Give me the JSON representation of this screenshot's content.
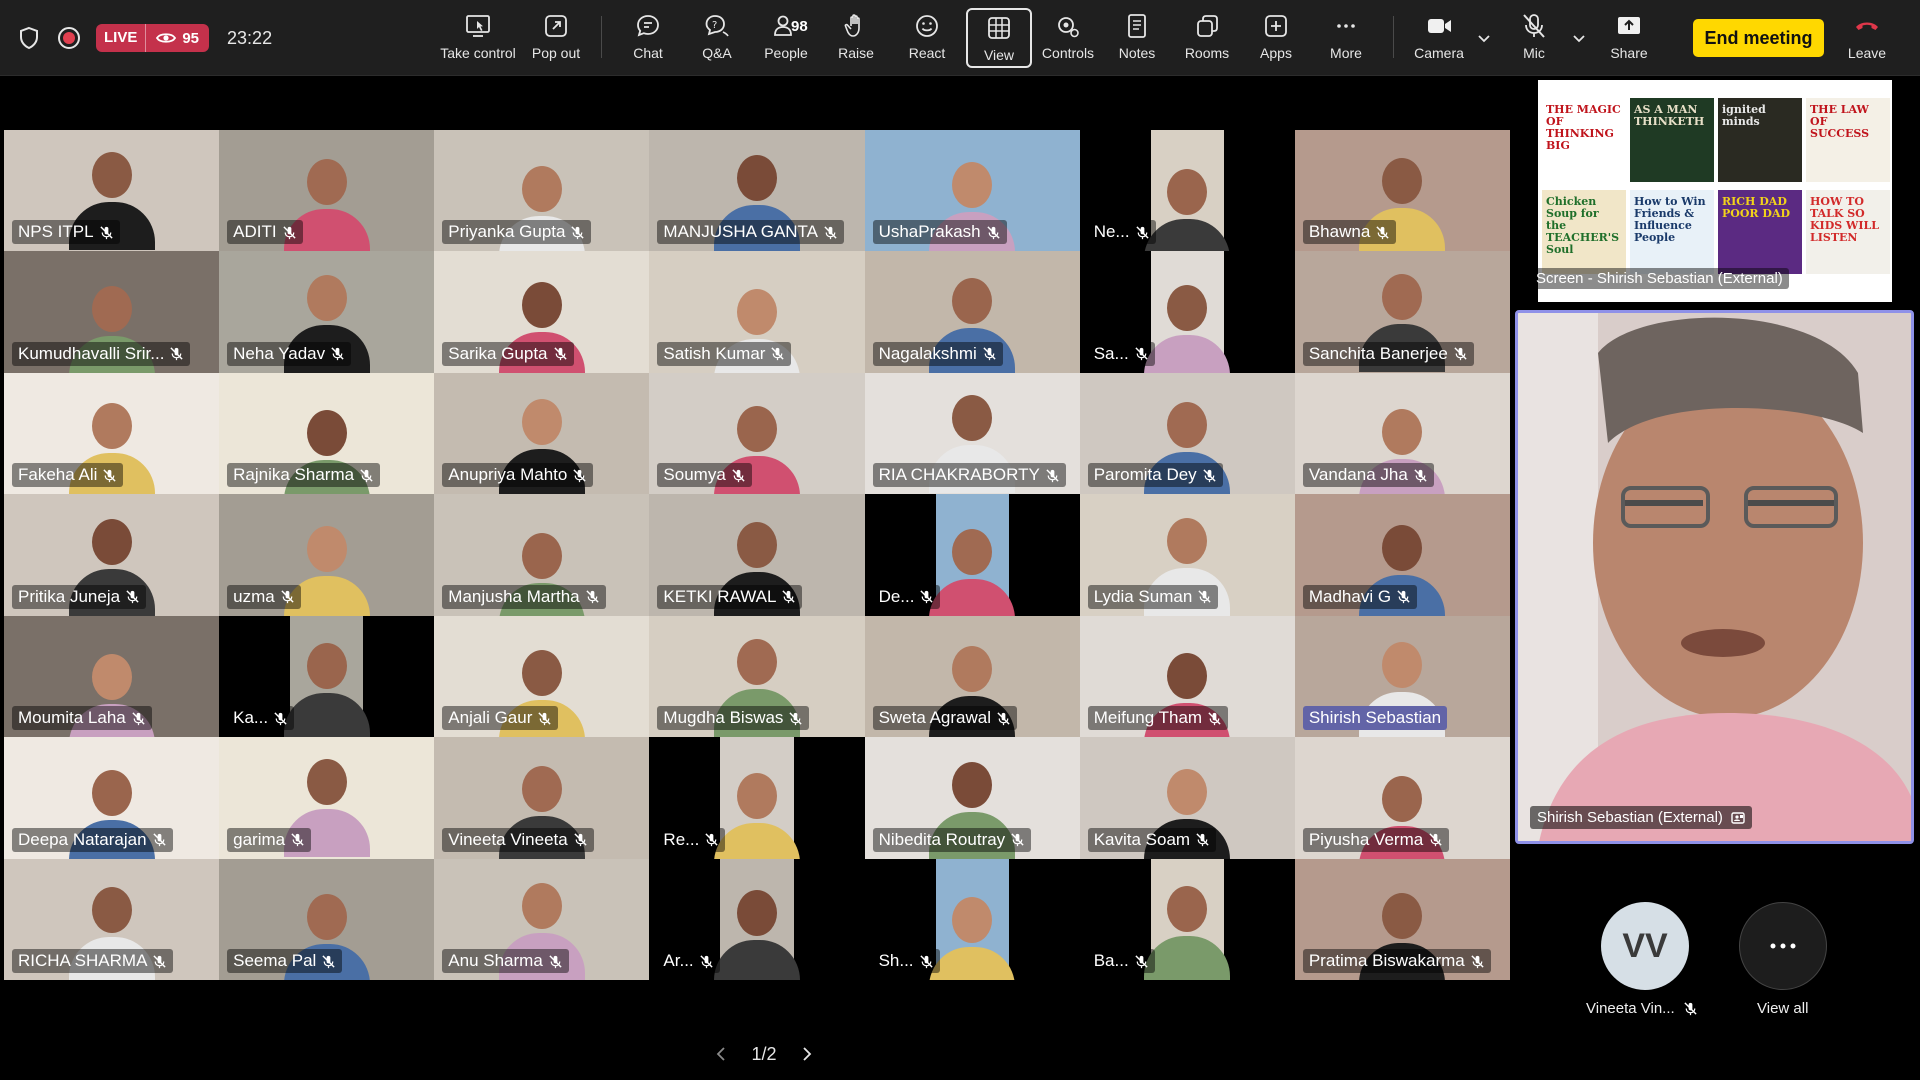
{
  "topbar": {
    "live_label": "LIVE",
    "viewer_count": "95",
    "timer": "23:22",
    "tools": {
      "take_control": "Take control",
      "pop_out": "Pop out",
      "chat": "Chat",
      "qa": "Q&A",
      "people": "People",
      "people_count": "98",
      "raise": "Raise",
      "react": "React",
      "view": "View",
      "controls": "Controls",
      "notes": "Notes",
      "rooms": "Rooms",
      "apps": "Apps",
      "more": "More",
      "camera": "Camera",
      "mic": "Mic",
      "share": "Share",
      "leave": "Leave"
    },
    "end_meeting": "End meeting"
  },
  "participants": [
    "NPS ITPL",
    "ADITI",
    "Priyanka Gupta",
    "MANJUSHA GANTA",
    "UshaPrakash",
    "Ne...",
    "Bhawna",
    "Kumudhavalli Srir...",
    "Neha Yadav",
    "Sarika Gupta",
    "Satish Kumar",
    "Nagalakshmi",
    "Sa...",
    "Sanchita Banerjee",
    "Fakeha Ali",
    "Rajnika Sharma",
    "Anupriya Mahto",
    "Soumya",
    "RIA CHAKRABORTY",
    "Paromita Dey",
    "Vandana Jha",
    "Pritika Juneja",
    "uzma",
    "Manjusha Martha",
    "KETKI RAWAL",
    "De...",
    "Lydia Suman",
    "Madhavi G",
    "Moumita Laha",
    "Ka...",
    "Anjali Gaur",
    "Mugdha Biswas",
    "Sweta Agrawal",
    "Meifung Tham",
    "Shirish Sebastian",
    "Deepa Natarajan",
    "garima",
    "Vineeta Vineeta",
    "Re...",
    "Nibedita Routray",
    "Kavita Soam",
    "Piyusha Verma",
    "RICHA SHARMA",
    "Seema Pal",
    "Anu Sharma",
    "Ar...",
    "Sh...",
    "Ba...",
    "Pratima Biswakarma"
  ],
  "screen_share": {
    "label": "Screen - Shirish Sebastian (External)",
    "books": [
      "THE MAGIC OF THINKING BIG",
      "AS A MAN THINKETH",
      "ignited minds",
      "THE LAW OF SUCCESS",
      "Chicken Soup for the TEACHER'S Soul",
      "How to Win Friends & Influence People",
      "RICH DAD POOR DAD",
      "HOW TO TALK SO KIDS WILL LISTEN"
    ]
  },
  "spotlight": {
    "label": "Shirish Sebastian (External)"
  },
  "sidebar": {
    "avatar_initials": "VV",
    "avatar_name": "Vineeta Vin...",
    "view_all": "View all"
  },
  "pager": {
    "text": "1/2"
  }
}
